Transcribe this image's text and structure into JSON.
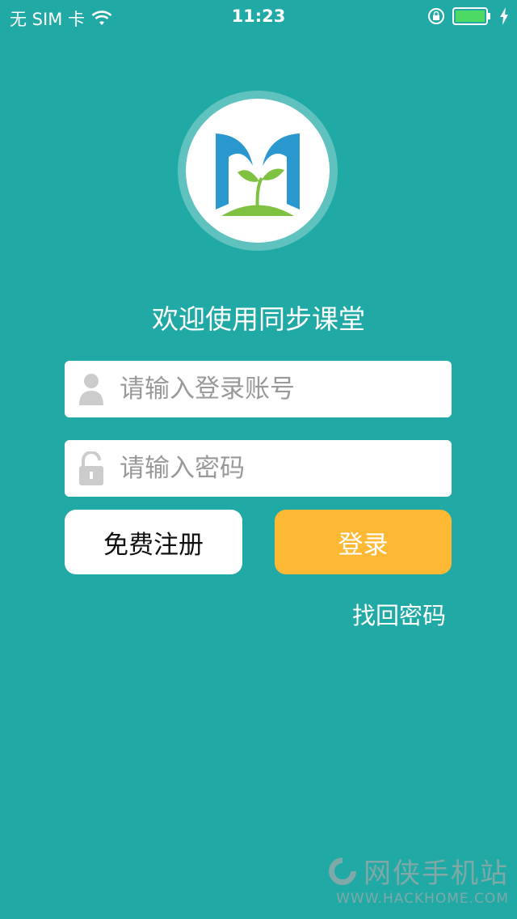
{
  "status_bar": {
    "carrier": "无 SIM 卡",
    "time": "11:23",
    "battery_level": 1.0
  },
  "app": {
    "welcome": "欢迎使用同步课堂"
  },
  "form": {
    "account_placeholder": "请输入登录账号",
    "password_placeholder": "请输入密码",
    "register_label": "免费注册",
    "login_label": "登录",
    "forgot_label": "找回密码"
  },
  "colors": {
    "background": "#21a9a5",
    "login_button": "#fdb933",
    "logo_blue": "#2b97cf",
    "logo_green": "#7fc241"
  },
  "watermark": {
    "cn": "网侠手机站",
    "en": "WWW.HACKHOME.COM"
  }
}
